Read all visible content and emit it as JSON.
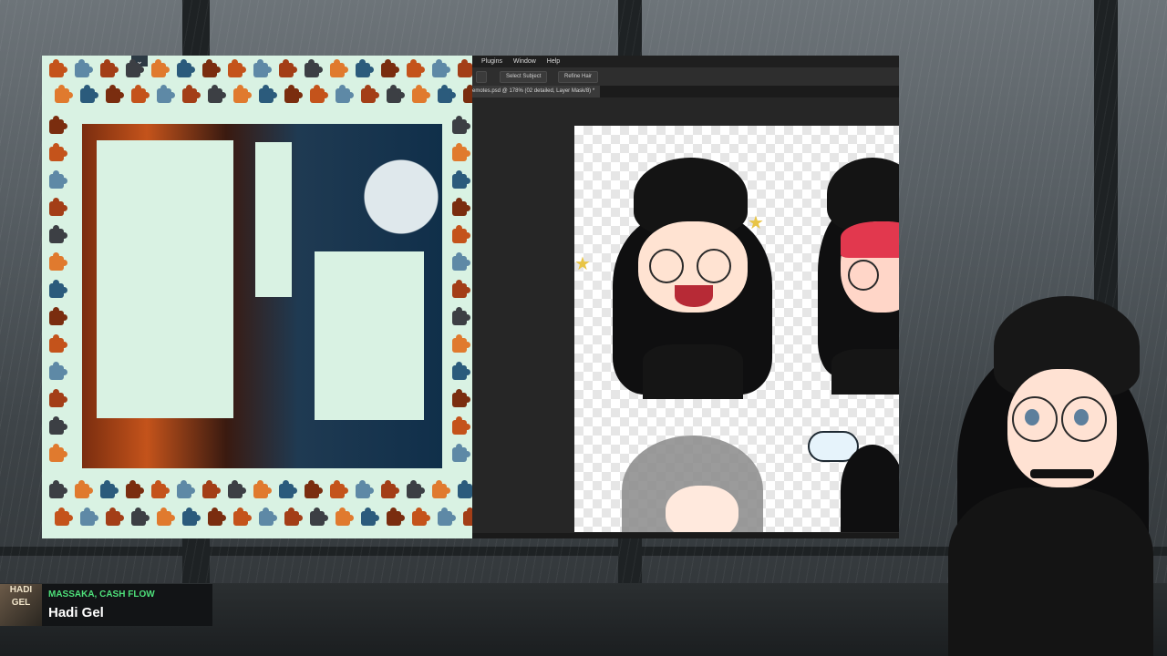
{
  "puzzle": {
    "collapse_icon": "chevron-double-down-icon",
    "collapse_glyph": "⌄"
  },
  "photoshop": {
    "menu": [
      "Plugins",
      "Window",
      "Help"
    ],
    "options": {
      "select_subject_label": "Select Subject",
      "refine_hair_label": "Refine Hair"
    },
    "document_tab": "emotes.psd @ 178% (02 detailed, Layer Mask/8) *"
  },
  "now_playing": {
    "artist": "MASSAKA, CASH FLOW",
    "title": "Hadi Gel",
    "album_art_text": "HADI GEL"
  },
  "colors": {
    "puzzle_bg": "#d9f2e3",
    "now_playing_accent": "#4ee07a",
    "ps_bg": "#262626"
  }
}
